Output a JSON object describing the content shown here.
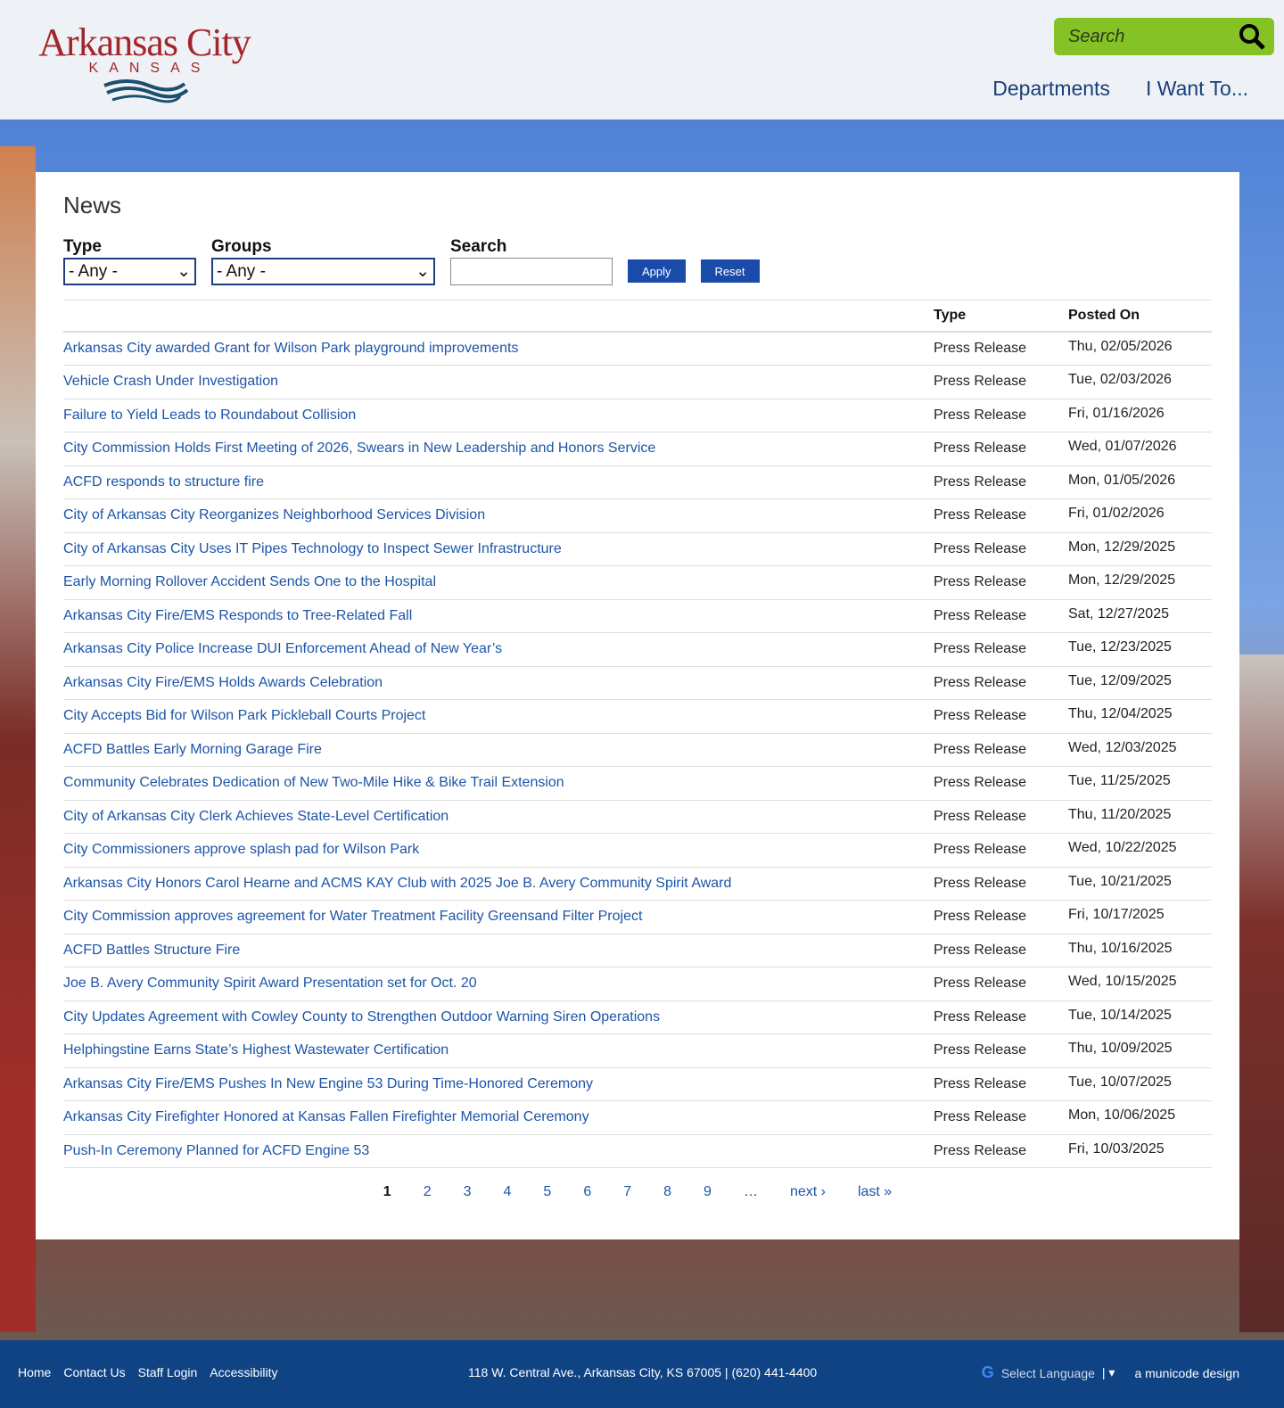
{
  "header": {
    "logo_title": "Arkansas City",
    "logo_subtitle": "KANSAS",
    "search_placeholder": "Search",
    "nav": [
      "Departments",
      "I Want To..."
    ]
  },
  "page": {
    "title": "News",
    "filters": {
      "type_label": "Type",
      "type_value": "- Any -",
      "groups_label": "Groups",
      "groups_value": "- Any -",
      "search_label": "Search",
      "search_value": "",
      "apply": "Apply",
      "reset": "Reset"
    },
    "columns": [
      "",
      "Type",
      "Posted On"
    ],
    "rows": [
      [
        "Arkansas City awarded Grant for Wilson Park playground improvements",
        "Press Release",
        "Thu, 02/05/2026"
      ],
      [
        "Vehicle Crash Under Investigation",
        "Press Release",
        "Tue, 02/03/2026"
      ],
      [
        "Failure to Yield Leads to Roundabout Collision",
        "Press Release",
        "Fri, 01/16/2026"
      ],
      [
        "City Commission Holds First Meeting of 2026, Swears in New Leadership and Honors Service",
        "Press Release",
        "Wed, 01/07/2026"
      ],
      [
        "ACFD responds to structure fire",
        "Press Release",
        "Mon, 01/05/2026"
      ],
      [
        "City of Arkansas City Reorganizes Neighborhood Services Division",
        "Press Release",
        "Fri, 01/02/2026"
      ],
      [
        "City of Arkansas City Uses IT Pipes Technology to Inspect Sewer Infrastructure",
        "Press Release",
        "Mon, 12/29/2025"
      ],
      [
        "Early Morning Rollover Accident Sends One to the Hospital",
        "Press Release",
        "Mon, 12/29/2025"
      ],
      [
        "Arkansas City Fire/EMS Responds to Tree-Related Fall",
        "Press Release",
        "Sat, 12/27/2025"
      ],
      [
        "Arkansas City Police Increase DUI Enforcement Ahead of New Year’s",
        "Press Release",
        "Tue, 12/23/2025"
      ],
      [
        "Arkansas City Fire/EMS Holds Awards Celebration",
        "Press Release",
        "Tue, 12/09/2025"
      ],
      [
        "City Accepts Bid for Wilson Park Pickleball Courts Project",
        "Press Release",
        "Thu, 12/04/2025"
      ],
      [
        "ACFD Battles Early Morning Garage Fire",
        "Press Release",
        "Wed, 12/03/2025"
      ],
      [
        "Community Celebrates Dedication of New Two-Mile Hike & Bike Trail Extension",
        "Press Release",
        "Tue, 11/25/2025"
      ],
      [
        "City of Arkansas City Clerk Achieves State-Level Certification",
        "Press Release",
        "Thu, 11/20/2025"
      ],
      [
        "City Commissioners approve splash pad for Wilson Park",
        "Press Release",
        "Wed, 10/22/2025"
      ],
      [
        "Arkansas City Honors Carol Hearne and ACMS KAY Club with 2025 Joe B. Avery Community Spirit Award",
        "Press Release",
        "Tue, 10/21/2025"
      ],
      [
        "City Commission approves agreement for Water Treatment Facility Greensand Filter Project",
        "Press Release",
        "Fri, 10/17/2025"
      ],
      [
        "ACFD Battles Structure Fire",
        "Press Release",
        "Thu, 10/16/2025"
      ],
      [
        "Joe B. Avery Community Spirit Award Presentation set for Oct. 20",
        "Press Release",
        "Wed, 10/15/2025"
      ],
      [
        "City Updates Agreement with Cowley County to Strengthen Outdoor Warning Siren Operations",
        "Press Release",
        "Tue, 10/14/2025"
      ],
      [
        "Helphingstine Earns State’s Highest Wastewater Certification",
        "Press Release",
        "Thu, 10/09/2025"
      ],
      [
        "Arkansas City Fire/EMS Pushes In New Engine 53 During Time-Honored Ceremony",
        "Press Release",
        "Tue, 10/07/2025"
      ],
      [
        "Arkansas City Firefighter Honored at Kansas Fallen Firefighter Memorial Ceremony",
        "Press Release",
        "Mon, 10/06/2025"
      ],
      [
        "Push-In Ceremony Planned for ACFD Engine 53",
        "Press Release",
        "Fri, 10/03/2025"
      ]
    ],
    "pager": [
      "1",
      "2",
      "3",
      "4",
      "5",
      "6",
      "7",
      "8",
      "9",
      "…",
      "next ›",
      "last »"
    ]
  },
  "footer": {
    "links": [
      "Home",
      "Contact Us",
      "Staff Login",
      "Accessibility"
    ],
    "address": "118 W. Central Ave., Arkansas City, KS 67005 | (620) 441-4400",
    "language": "Select Language",
    "credit": "a municode design"
  }
}
